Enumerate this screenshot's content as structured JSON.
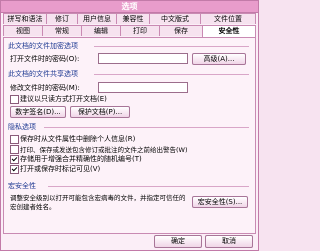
{
  "window": {
    "title": "选项"
  },
  "tabs_row1": [
    "拼写和语法",
    "修订",
    "用户信息",
    "兼容性",
    "中文版式",
    "文件位置"
  ],
  "tabs_row2": [
    "视图",
    "常规",
    "编辑",
    "打印",
    "保存",
    "安全性"
  ],
  "active_tab": "安全性",
  "encrypt": {
    "section": "此文档的文件加密选项",
    "open_password_label": "打开文件时的密码(O):",
    "advanced_button": "高级(A)..."
  },
  "sharing": {
    "section": "此文档的文件共享选项",
    "modify_password_label": "修改文件时的密码(M):",
    "readonly_label": "建议以只读方式打开文档(E)",
    "digital_signature_button": "数字签名(D)...",
    "protect_document_button": "保护文档(P)..."
  },
  "privacy": {
    "section": "隐私选项",
    "options": [
      {
        "label": "保存时从文件属性中删除个人信息(R)",
        "checked": false
      },
      {
        "label": "打印、保存或发送包含修订或批注的文件之前给出警告(W)",
        "checked": false
      },
      {
        "label": "存储用于增强合并精确性的随机编号(T)",
        "checked": true
      },
      {
        "label": "打开或保存时标记可见(V)",
        "checked": true
      }
    ]
  },
  "macro": {
    "section": "宏安全性",
    "description": "调整安全级别以打开可能包含宏病毒的文件，并指定可信任的宏创建者姓名。",
    "button": "宏安全性(S)..."
  },
  "footer": {
    "ok": "确定",
    "cancel": "取消"
  }
}
